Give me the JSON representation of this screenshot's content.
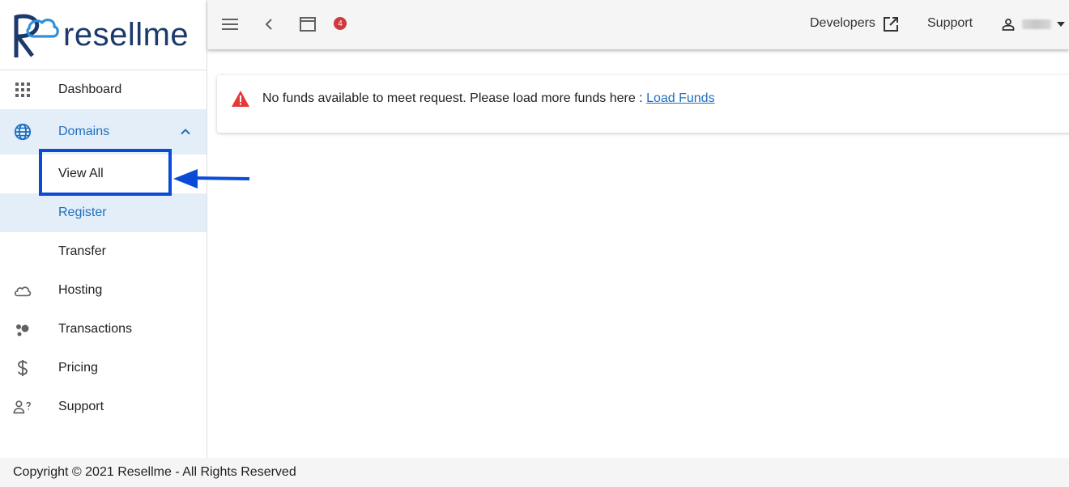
{
  "brand": {
    "name": "resellme"
  },
  "sidebar": {
    "items": [
      {
        "label": "Dashboard",
        "icon": "grid-icon"
      },
      {
        "label": "Domains",
        "icon": "globe-icon",
        "expanded": true,
        "children": [
          {
            "label": "View All"
          },
          {
            "label": "Register"
          },
          {
            "label": "Transfer"
          }
        ]
      },
      {
        "label": "Hosting",
        "icon": "cloud-icon"
      },
      {
        "label": "Transactions",
        "icon": "bubbles-icon"
      },
      {
        "label": "Pricing",
        "icon": "dollar-icon"
      },
      {
        "label": "Support",
        "icon": "person-question-icon"
      }
    ]
  },
  "topbar": {
    "notification_count": "4",
    "developers_label": "Developers",
    "support_label": "Support"
  },
  "alert": {
    "message": "No funds available to meet request. Please load more funds here : ",
    "link_label": "Load Funds"
  },
  "footer": {
    "copyright": "Copyright © 2021 Resellme - All Rights Reserved"
  },
  "colors": {
    "accent": "#1e6fbf",
    "active_bg": "#e3eef9",
    "highlight": "#0a4bd6",
    "badge": "#d0393e",
    "brand": "#1b3a6b"
  }
}
